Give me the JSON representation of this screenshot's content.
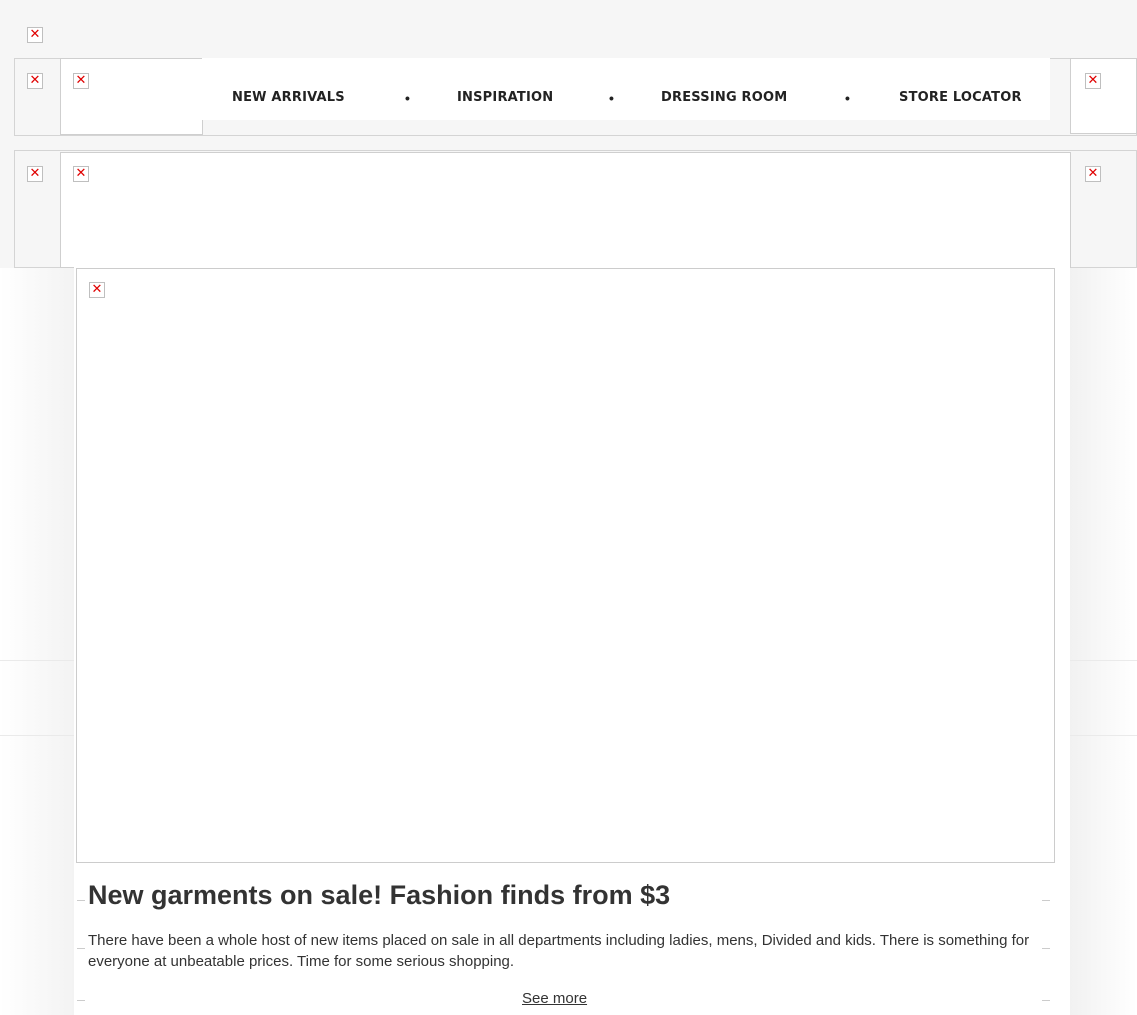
{
  "colors": {
    "background": "#f6f6f6",
    "broken_icon": "#e00000",
    "text": "#333333"
  },
  "navigation": {
    "items": [
      {
        "label": "NEW ARRIVALS"
      },
      {
        "label": "INSPIRATION"
      },
      {
        "label": "DRESSING ROOM"
      },
      {
        "label": "STORE LOCATOR"
      }
    ],
    "separator": "•"
  },
  "broken_image_glyph": "✕",
  "article": {
    "headline": "New garments on sale! Fashion finds from $3",
    "body": "There have been a whole host of new items placed on sale in all departments including ladies, mens, Divided and kids. There is something for everyone at unbeatable prices. Time for some serious shopping.",
    "link_label": "See more"
  }
}
